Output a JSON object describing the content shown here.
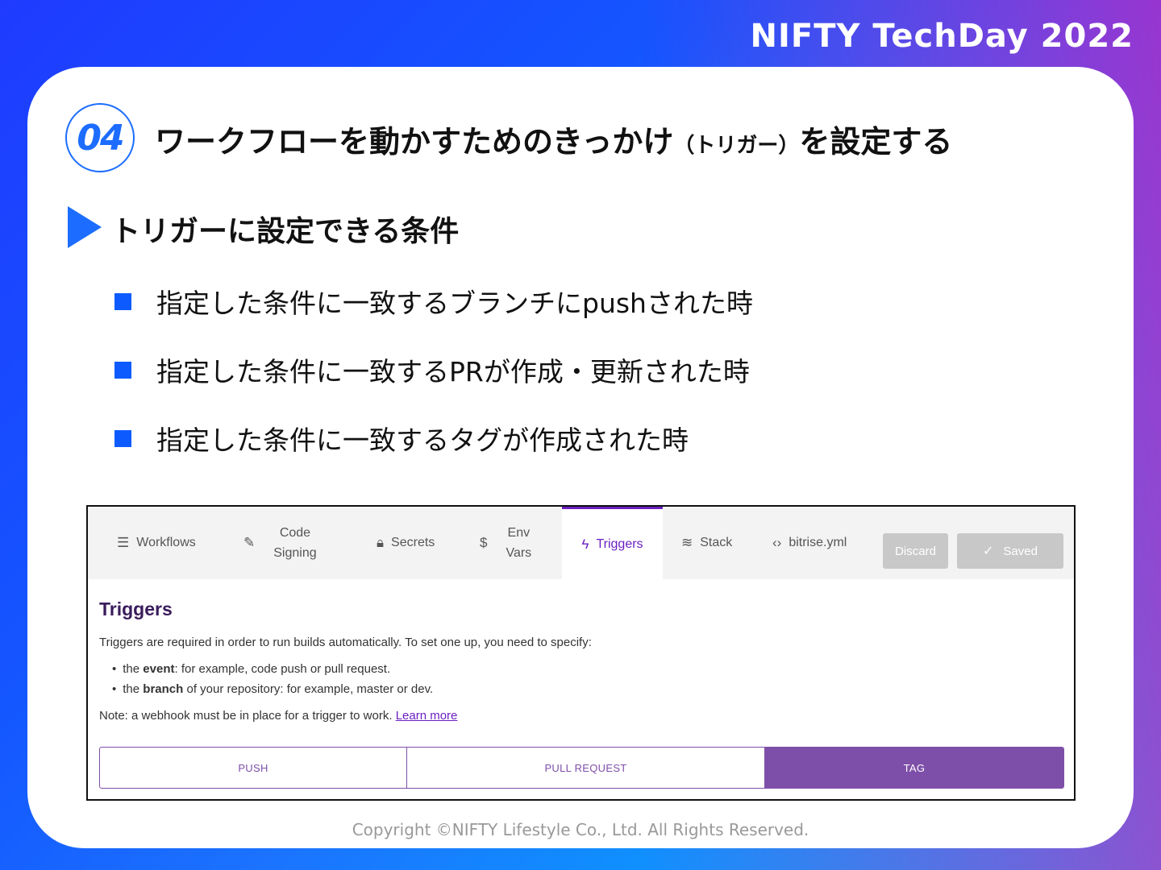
{
  "brand": "NIFTY TechDay 2022",
  "slide": {
    "number": "04",
    "title_main": "ワークフローを動かすためのきっかけ",
    "title_paren": "（トリガー）",
    "title_tail": "を設定する",
    "subtitle": "トリガーに設定できる条件",
    "bullets": [
      "指定した条件に一致するブランチにpushされた時",
      "指定した条件に一致するPRが作成・更新された時",
      "指定した条件に一致するタグが作成された時"
    ]
  },
  "screenshot": {
    "tabs": [
      {
        "label": "Workflows",
        "icon": "list-icon"
      },
      {
        "label_line1": "Code",
        "label_line2": "Signing",
        "icon": "edit-icon"
      },
      {
        "label": "Secrets",
        "icon": "lock-icon"
      },
      {
        "label_line1": "Env",
        "label_line2": "Vars",
        "icon": "dollar-icon"
      },
      {
        "label": "Triggers",
        "icon": "bolt-icon",
        "active": true
      },
      {
        "label": "Stack",
        "icon": "layers-icon"
      },
      {
        "label": "bitrise.yml",
        "icon": "code-icon"
      }
    ],
    "discard_label": "Discard",
    "saved_label": "Saved",
    "heading": "Triggers",
    "description": "Triggers are required in order to run builds automatically. To set one up, you need to specify:",
    "list": [
      {
        "pre": "the ",
        "bold": "event",
        "post": ": for example, code push or pull request."
      },
      {
        "pre": "the ",
        "bold": "branch",
        "post": " of your repository: for example, master or dev."
      }
    ],
    "note": "Note: a webhook must be in place for a trigger to work.",
    "note_link": "Learn more",
    "segments": [
      "PUSH",
      "PULL REQUEST",
      "TAG"
    ],
    "active_segment": "TAG",
    "accent_color": "#7e4fa8"
  },
  "footer": "Copyright ©NIFTY Lifestyle Co., Ltd. All Rights Reserved."
}
